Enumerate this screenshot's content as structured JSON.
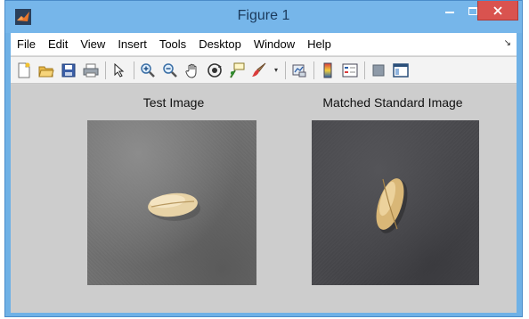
{
  "window": {
    "title": "Figure 1",
    "accent_color": "#76b6ea",
    "close_color": "#d9534f"
  },
  "menu": {
    "items": [
      "File",
      "Edit",
      "View",
      "Insert",
      "Tools",
      "Desktop",
      "Window",
      "Help"
    ]
  },
  "toolbar": {
    "icons": [
      "new-figure-icon",
      "open-file-icon",
      "save-icon",
      "print-icon",
      "pointer-icon",
      "zoom-in-icon",
      "zoom-out-icon",
      "pan-hand-icon",
      "rotate-3d-icon",
      "data-cursor-icon",
      "brush-icon",
      "brush-dropdown-icon",
      "link-plot-icon",
      "colorbar-icon",
      "legend-icon",
      "hide-plot-tools-icon",
      "show-plot-tools-icon"
    ]
  },
  "axes": [
    {
      "title": "Test Image",
      "subject": "wheat grain lying horizontally on grey surface"
    },
    {
      "title": "Matched Standard Image",
      "subject": "wheat grain standing diagonally on dark surface"
    }
  ]
}
